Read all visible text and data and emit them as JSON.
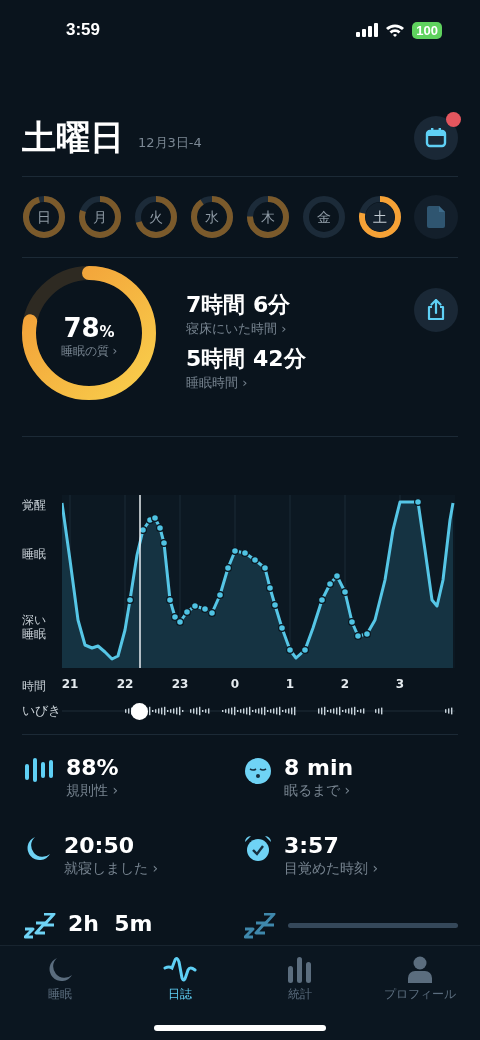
{
  "status_bar": {
    "time": "3:59",
    "battery": "100"
  },
  "header": {
    "title": "土曜日",
    "date": "12月3日-4",
    "has_notification": true
  },
  "week": [
    {
      "label": "日",
      "selected": false
    },
    {
      "label": "月",
      "selected": false
    },
    {
      "label": "火",
      "selected": false
    },
    {
      "label": "水",
      "selected": false
    },
    {
      "label": "木",
      "selected": false
    },
    {
      "label": "金",
      "selected": false
    },
    {
      "label": "土",
      "selected": true
    }
  ],
  "summary": {
    "quality": {
      "value": "78",
      "unit": "%",
      "label": "睡眠の質 ›"
    },
    "metrics": [
      {
        "value": "7時間 6分",
        "label": "寝床にいた時間 ›"
      },
      {
        "value": "5時間 42分",
        "label": "睡眠時間 ›"
      }
    ]
  },
  "hypnogram": {
    "stage_labels": [
      "覚醒",
      "睡眠",
      "深い睡眠"
    ],
    "time_label": "時間",
    "hours": [
      "21",
      "22",
      "23",
      "0",
      "1",
      "2",
      "3"
    ],
    "snore_label": "いびき"
  },
  "stats": [
    {
      "kind": "bars",
      "value": "88%",
      "label": "規則性 ›"
    },
    {
      "kind": "face",
      "value": "8 min",
      "label": "眠るまで ›"
    },
    {
      "kind": "moon",
      "value": "20:50",
      "label": "就寝しました ›"
    },
    {
      "kind": "alarm",
      "value": "3:57",
      "label": "目覚めた時刻 ›"
    },
    {
      "kind": "zzz",
      "value": "2h  5m"
    },
    {
      "kind": "zzz",
      "loading": true
    }
  ],
  "tabs": [
    {
      "kind": "moon",
      "label": "睡眠",
      "selected": false
    },
    {
      "kind": "wave",
      "label": "日誌",
      "selected": true
    },
    {
      "kind": "bars",
      "label": "統計",
      "selected": false
    },
    {
      "kind": "person",
      "label": "プロフィール",
      "selected": false
    }
  ]
}
